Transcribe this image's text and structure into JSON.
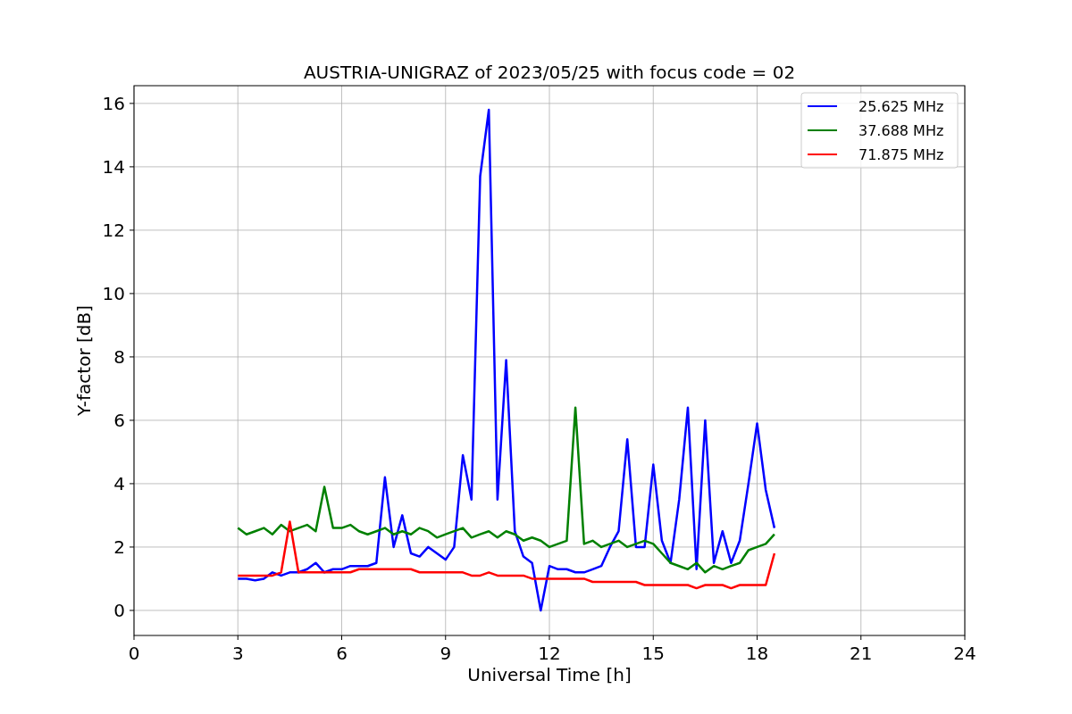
{
  "chart_data": {
    "type": "line",
    "title": "AUSTRIA-UNIGRAZ of 2023/05/25 with focus code = 02",
    "xlabel": "Universal Time [h]",
    "ylabel": "Y-factor [dB]",
    "x": [
      3,
      3.25,
      3.5,
      3.75,
      4,
      4.25,
      4.5,
      4.75,
      5,
      5.25,
      5.5,
      5.75,
      6,
      6.25,
      6.5,
      6.75,
      7,
      7.25,
      7.5,
      7.75,
      8,
      8.25,
      8.5,
      8.75,
      9,
      9.25,
      9.5,
      9.75,
      10,
      10.25,
      10.5,
      10.75,
      11,
      11.25,
      11.5,
      11.75,
      12,
      12.25,
      12.5,
      12.75,
      13,
      13.25,
      13.5,
      13.75,
      14,
      14.25,
      14.5,
      14.75,
      15,
      15.25,
      15.5,
      15.75,
      16,
      16.25,
      16.5,
      16.75,
      17,
      17.25,
      17.5,
      17.75,
      18,
      18.25,
      18.5
    ],
    "series": [
      {
        "name": "25.625 MHz",
        "color": "#0000ff",
        "values": [
          1.0,
          1.0,
          0.95,
          1.0,
          1.2,
          1.1,
          1.2,
          1.2,
          1.3,
          1.5,
          1.2,
          1.3,
          1.3,
          1.4,
          1.4,
          1.4,
          1.5,
          4.2,
          2.0,
          3.0,
          1.8,
          1.7,
          2.0,
          1.8,
          1.6,
          2.0,
          4.9,
          3.5,
          13.7,
          15.8,
          3.5,
          7.9,
          2.5,
          1.7,
          1.5,
          0.0,
          1.4,
          1.3,
          1.3,
          1.2,
          1.2,
          1.3,
          1.4,
          2.0,
          2.5,
          5.4,
          2.0,
          2.0,
          4.6,
          2.2,
          1.5,
          3.5,
          6.4,
          1.3,
          6.0,
          1.5,
          2.5,
          1.5,
          2.2,
          4.0,
          5.9,
          3.8,
          2.6
        ]
      },
      {
        "name": "37.688 MHz",
        "color": "#008000",
        "values": [
          2.6,
          2.4,
          2.5,
          2.6,
          2.4,
          2.7,
          2.5,
          2.6,
          2.7,
          2.5,
          3.9,
          2.6,
          2.6,
          2.7,
          2.5,
          2.4,
          2.5,
          2.6,
          2.4,
          2.5,
          2.4,
          2.6,
          2.5,
          2.3,
          2.4,
          2.5,
          2.6,
          2.3,
          2.4,
          2.5,
          2.3,
          2.5,
          2.4,
          2.2,
          2.3,
          2.2,
          2.0,
          2.1,
          2.2,
          6.4,
          2.1,
          2.2,
          2.0,
          2.1,
          2.2,
          2.0,
          2.1,
          2.2,
          2.1,
          1.8,
          1.5,
          1.4,
          1.3,
          1.5,
          1.2,
          1.4,
          1.3,
          1.4,
          1.5,
          1.9,
          2.0,
          2.1,
          2.4
        ]
      },
      {
        "name": "71.875 MHz",
        "color": "#ff0000",
        "values": [
          1.1,
          1.1,
          1.1,
          1.1,
          1.1,
          1.2,
          2.8,
          1.2,
          1.2,
          1.2,
          1.2,
          1.2,
          1.2,
          1.2,
          1.3,
          1.3,
          1.3,
          1.3,
          1.3,
          1.3,
          1.3,
          1.2,
          1.2,
          1.2,
          1.2,
          1.2,
          1.2,
          1.1,
          1.1,
          1.2,
          1.1,
          1.1,
          1.1,
          1.1,
          1.0,
          1.0,
          1.0,
          1.0,
          1.0,
          1.0,
          1.0,
          0.9,
          0.9,
          0.9,
          0.9,
          0.9,
          0.9,
          0.8,
          0.8,
          0.8,
          0.8,
          0.8,
          0.8,
          0.7,
          0.8,
          0.8,
          0.8,
          0.7,
          0.8,
          0.8,
          0.8,
          0.8,
          1.8
        ]
      }
    ],
    "grid": true,
    "legend": true,
    "xlim": [
      0,
      24
    ],
    "ylim": [
      -0.79,
      16.56
    ],
    "xticks": [
      0,
      3,
      6,
      9,
      12,
      15,
      18,
      21,
      24
    ],
    "yticks": [
      0,
      2,
      4,
      6,
      8,
      10,
      12,
      14,
      16
    ]
  }
}
